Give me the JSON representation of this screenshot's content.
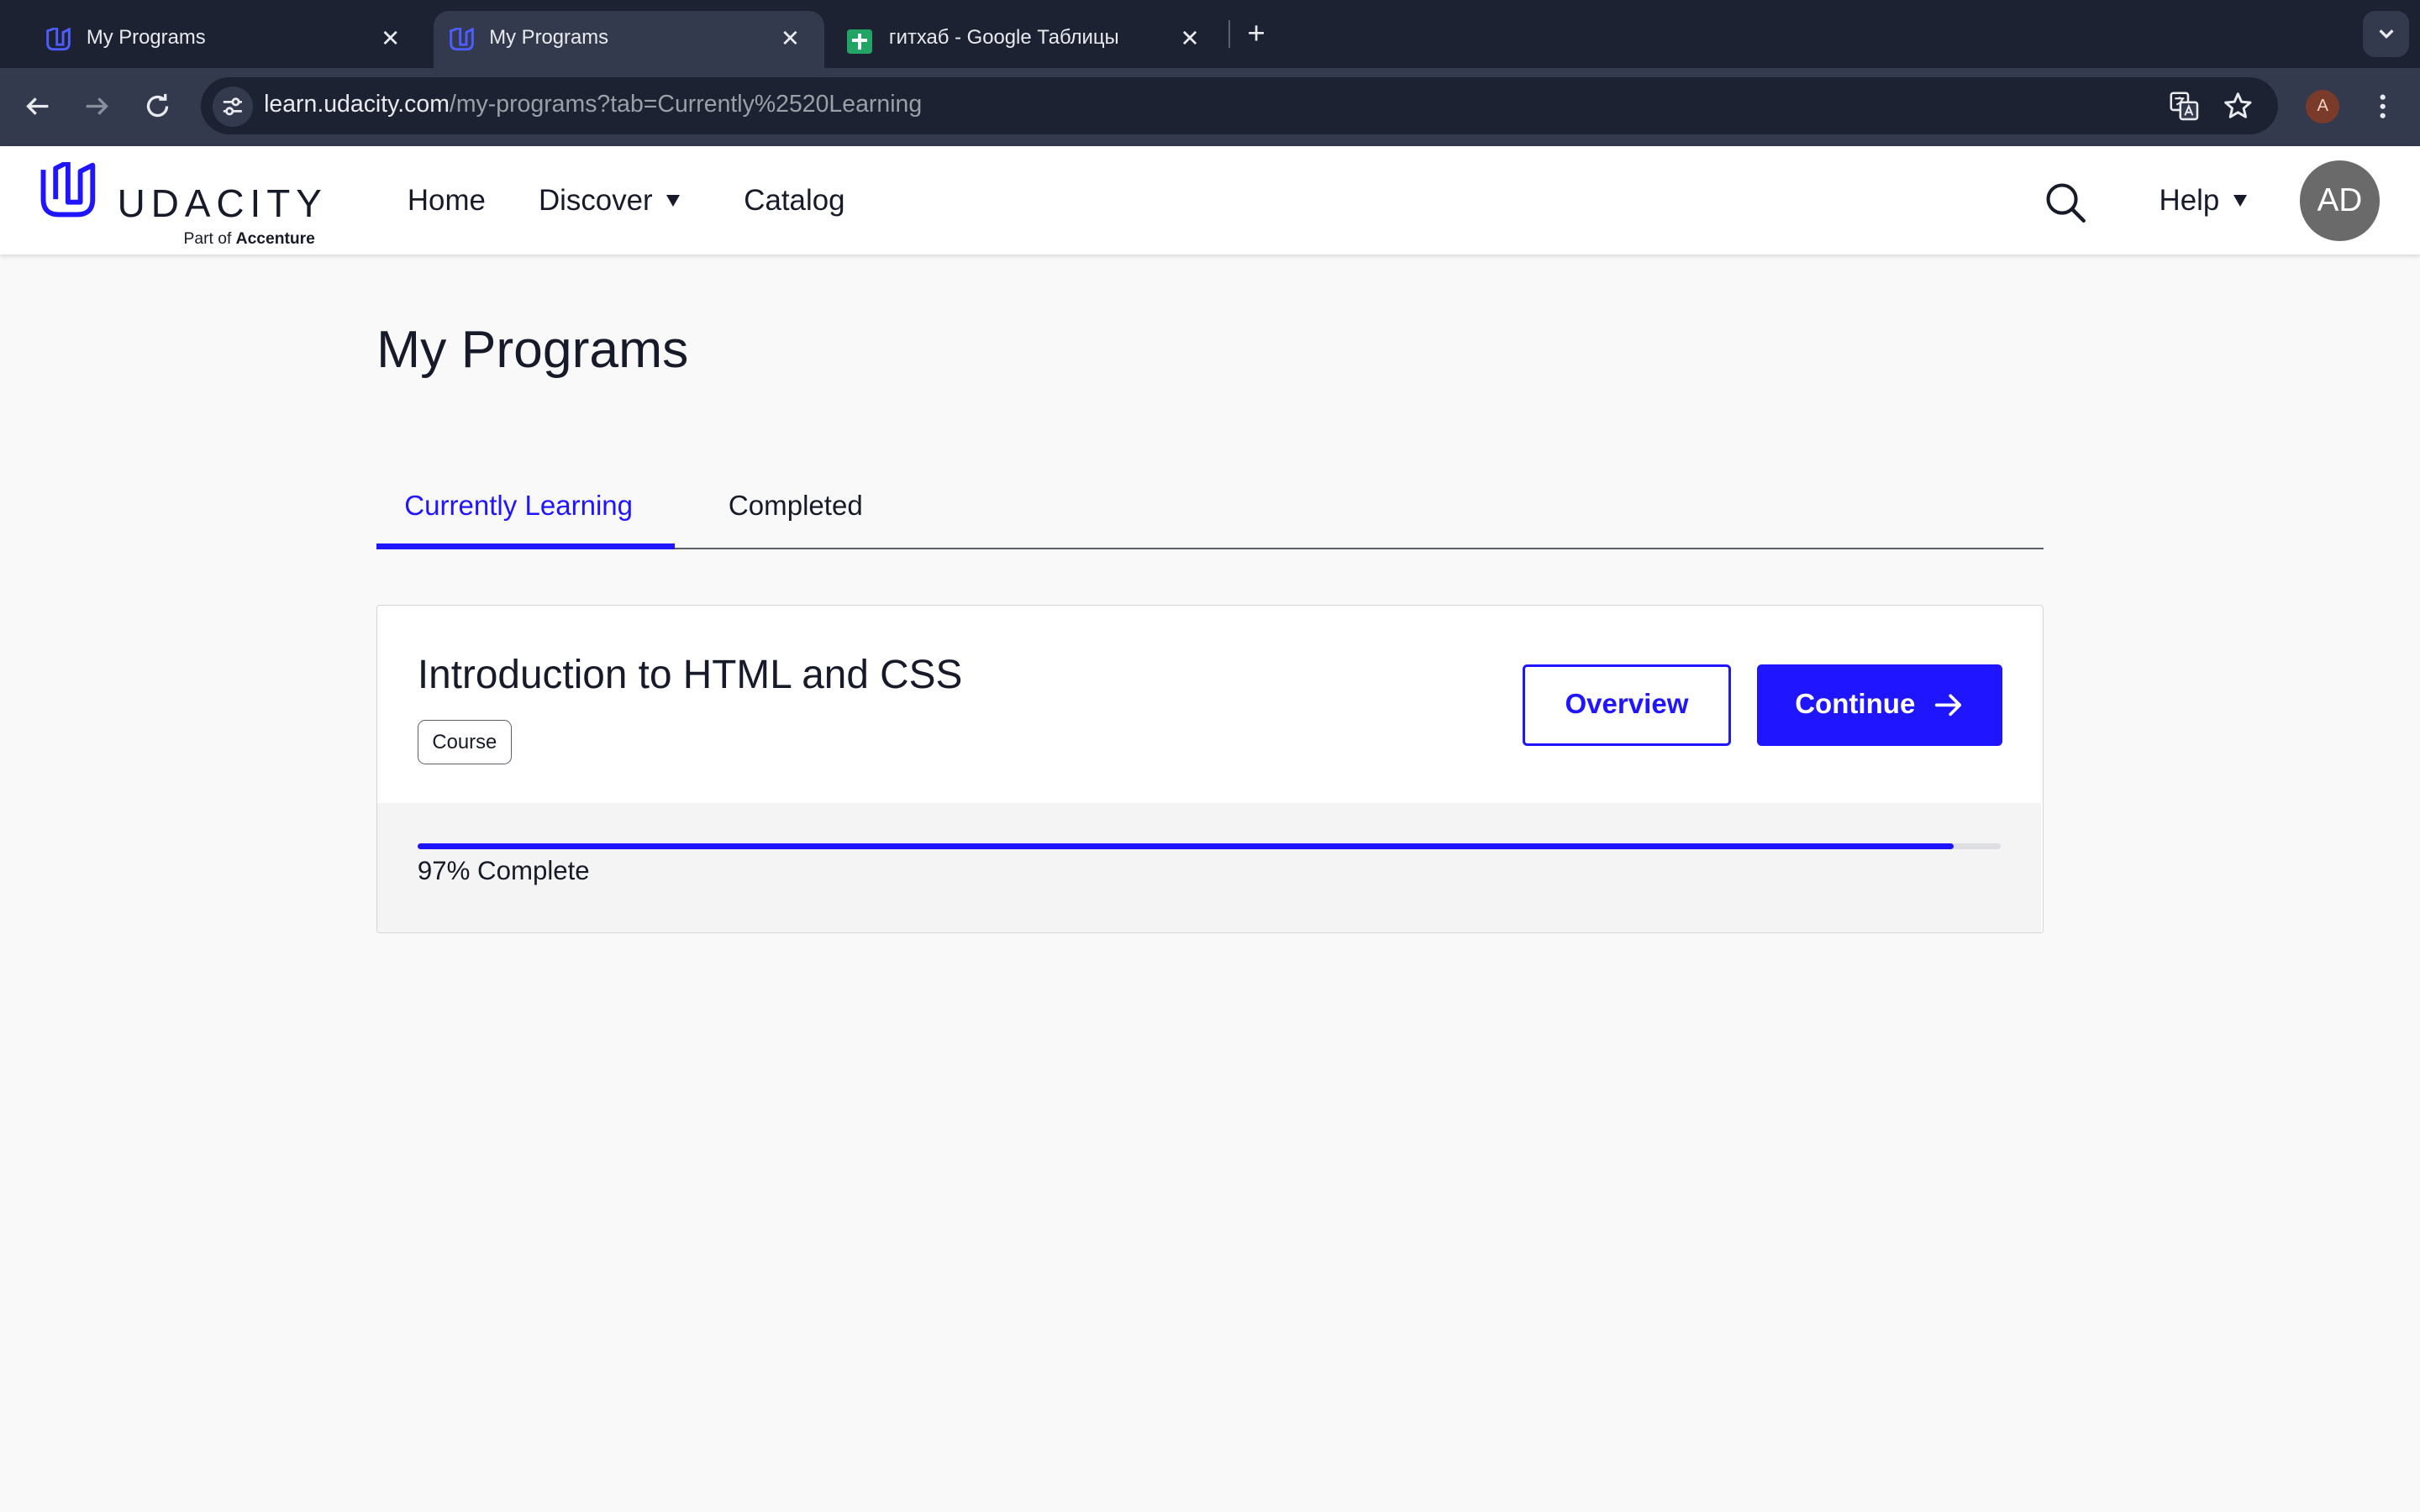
{
  "browser": {
    "tabs": [
      {
        "title": "My Programs",
        "active": false,
        "favicon": "udacity-logo-icon"
      },
      {
        "title": "My Programs",
        "active": true,
        "favicon": "udacity-logo-icon"
      },
      {
        "title": "гитхаб - Google Таблицы",
        "active": false,
        "favicon": "google-sheets-icon"
      }
    ],
    "url_host": "learn.udacity.com",
    "url_path": "/my-programs?tab=Currently%2520Learning",
    "profile_initial": "A"
  },
  "header": {
    "logo_word": "UDACITY",
    "logo_sub_prefix": "Part of",
    "logo_sub_brand": "Accenture",
    "nav": {
      "home": "Home",
      "discover": "Discover",
      "catalog": "Catalog",
      "help": "Help"
    },
    "avatar_initials": "AD"
  },
  "page": {
    "title": "My Programs",
    "tabs": {
      "current": "Currently Learning",
      "completed": "Completed"
    },
    "programs": [
      {
        "title": "Introduction to HTML and CSS",
        "badge": "Course",
        "overview_label": "Overview",
        "continue_label": "Continue",
        "progress_fraction": 0.97,
        "progress_label": "97% Complete"
      }
    ]
  },
  "colors": {
    "accent": "#2015ff",
    "text": "#171a29",
    "chrome_dark": "#1d2233",
    "chrome_mid": "#343a4d"
  }
}
